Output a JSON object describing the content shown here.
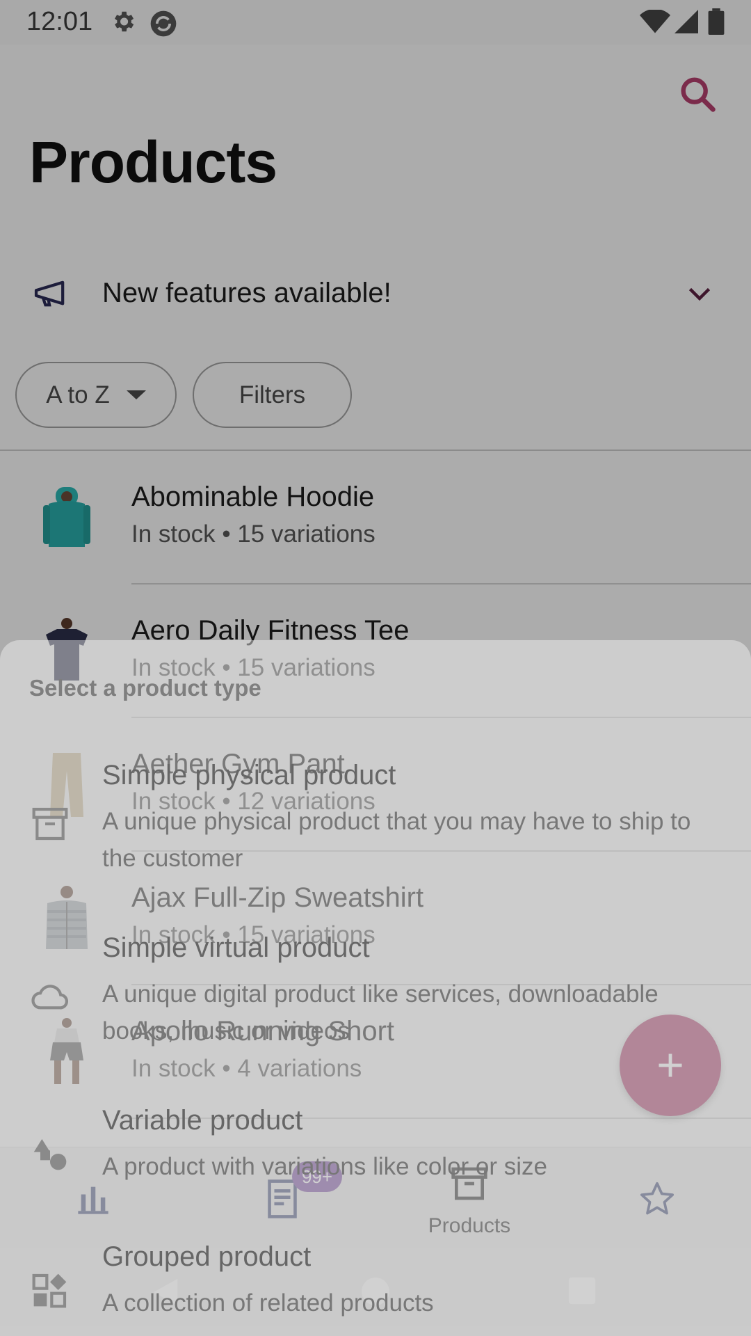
{
  "status_bar": {
    "time": "12:01"
  },
  "header": {
    "title": "Products",
    "search_icon": "search-icon"
  },
  "banner": {
    "label": "New features available!"
  },
  "chips": {
    "sort_label": "A to Z",
    "filters_label": "Filters"
  },
  "products": [
    {
      "name": "Abominable Hoodie",
      "status": "In stock • 15 variations",
      "image": "teal hoodie"
    },
    {
      "name": "Aero Daily Fitness Tee",
      "status": "In stock • 15 variations",
      "image": "navy tee"
    },
    {
      "name": "Aether Gym Pant",
      "status": "In stock • 12 variations",
      "image": "khaki pants"
    },
    {
      "name": "Ajax Full-Zip Sweatshirt",
      "status": "In stock • 15 variations",
      "image": "grey striped sweatshirt"
    },
    {
      "name": "Apollo Running Short",
      "status": "In stock • 4 variations",
      "image": "grey shorts"
    }
  ],
  "bottom_nav": {
    "items": [
      {
        "name": "stats",
        "icon": "bar-chart-icon",
        "label": ""
      },
      {
        "name": "orders",
        "icon": "orders-icon",
        "label": "",
        "badge": "99+"
      },
      {
        "name": "products",
        "icon": "products-icon",
        "label": "Products"
      },
      {
        "name": "reviews",
        "icon": "star-icon",
        "label": ""
      }
    ]
  },
  "sheet": {
    "title": "Select a product type",
    "options": [
      {
        "title": "Simple physical product",
        "description": "A unique physical product that you may have to ship to the customer",
        "icon": "box-icon"
      },
      {
        "title": "Simple virtual product",
        "description": "A unique digital product like services, downloadable books, music or videos",
        "icon": "cloud-icon"
      },
      {
        "title": "Variable product",
        "description": "A product with variations like color or size",
        "icon": "shapes-icon"
      },
      {
        "title": "Grouped product",
        "description": "A collection of related products",
        "icon": "widgets-icon"
      }
    ]
  },
  "colors": {
    "accent": "#b03e6c",
    "badge": "#7b4ea6",
    "scrim": "rgba(0,0,0,0.30)"
  }
}
